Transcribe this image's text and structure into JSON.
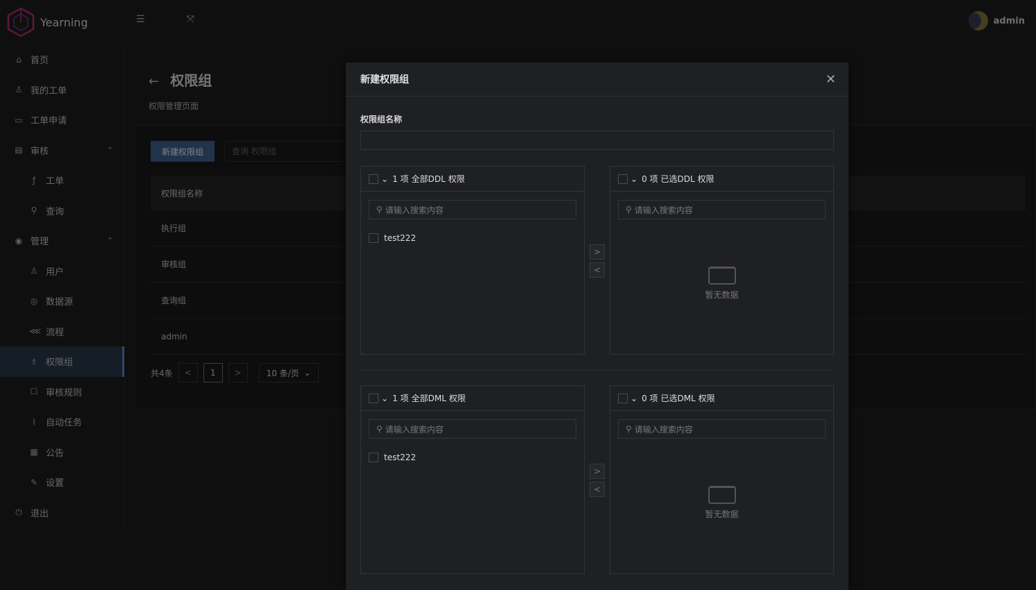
{
  "app": {
    "logo_text": "Yearning",
    "user_name": "admin"
  },
  "sidebar": {
    "items": [
      {
        "label": "首页",
        "icon": "home-icon",
        "glyph": "⌂"
      },
      {
        "label": "我的工单",
        "icon": "user-icon",
        "glyph": "♙"
      },
      {
        "label": "工单申请",
        "icon": "monitor-icon",
        "glyph": "▭"
      },
      {
        "label": "审核",
        "icon": "audit-icon",
        "glyph": "▤",
        "group": true
      },
      {
        "label": "工单",
        "icon": "function-icon",
        "glyph": "ƒ",
        "sub": true
      },
      {
        "label": "查询",
        "icon": "search-icon",
        "glyph": "⚲",
        "sub": true
      },
      {
        "label": "管理",
        "icon": "eye-icon",
        "glyph": "◉",
        "group": true
      },
      {
        "label": "用户",
        "icon": "user-icon",
        "glyph": "♙",
        "sub": true
      },
      {
        "label": "数据源",
        "icon": "database-icon",
        "glyph": "◎",
        "sub": true
      },
      {
        "label": "流程",
        "icon": "flow-icon",
        "glyph": "⋘",
        "sub": true
      },
      {
        "label": "权限组",
        "icon": "team-icon",
        "glyph": "♗",
        "sub": true,
        "active": true
      },
      {
        "label": "审核规则",
        "icon": "rule-icon",
        "glyph": "☐",
        "sub": true
      },
      {
        "label": "自动任务",
        "icon": "clip-icon",
        "glyph": "⌇",
        "sub": true
      },
      {
        "label": "公告",
        "icon": "chart-icon",
        "glyph": "▦",
        "sub": true
      },
      {
        "label": "设置",
        "icon": "tool-icon",
        "glyph": "✎",
        "sub": true
      },
      {
        "label": "退出",
        "icon": "logout-icon",
        "glyph": "⏻"
      }
    ]
  },
  "page": {
    "title": "权限组",
    "subtitle": "权限管理页面",
    "new_button": "新建权限组",
    "search_placeholder": "查询 权限组",
    "table_header": "权限组名称",
    "rows": [
      "执行组",
      "审核组",
      "查询组",
      "admin"
    ],
    "pager": {
      "total": "共4条",
      "current": "1",
      "page_size": "10 条/页"
    }
  },
  "modal": {
    "title": "新建权限组",
    "name_label": "权限组名称",
    "ddl_left": {
      "count": "1 项",
      "title": "全部DDL 权限",
      "search_placeholder": "请输入搜索内容",
      "item": "test222"
    },
    "ddl_right": {
      "count": "0 项",
      "title": "已选DDL 权限",
      "search_placeholder": "请输入搜索内容",
      "empty": "暂无数据"
    },
    "dml_left": {
      "count": "1 项",
      "title": "全部DML 权限",
      "search_placeholder": "请输入搜索内容",
      "item": "test222"
    },
    "dml_right": {
      "count": "0 项",
      "title": "已选DML 权限",
      "search_placeholder": "请输入搜索内容",
      "empty": "暂无数据"
    }
  }
}
